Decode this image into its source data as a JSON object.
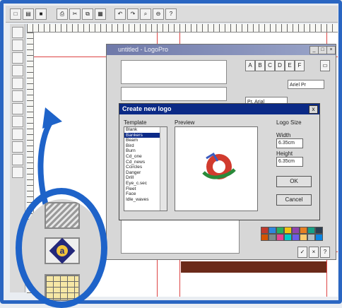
{
  "toolbar": {
    "icons": [
      "new-icon",
      "open-icon",
      "save-icon",
      "print-icon",
      "cut-icon",
      "copy-icon",
      "paste-icon",
      "undo-icon",
      "redo-icon",
      "zoom-icon",
      "zoom-out-icon",
      "help-icon"
    ]
  },
  "editor_window": {
    "title": "untitled - LogoPro",
    "text_style_buttons": [
      "A",
      "B",
      "C",
      "D",
      "E",
      "F"
    ],
    "font_combo_value": "Ariel Pr",
    "style_combo_value": "Pr. Arial"
  },
  "dialog": {
    "title": "Create new logo",
    "template_label": "Template",
    "preview_label": "Preview",
    "logo_size_label": "Logo Size",
    "width_label": "Width",
    "width_value": "6.35cm",
    "height_label": "Height",
    "height_value": "6.35cm",
    "ok_label": "OK",
    "cancel_label": "Cancel",
    "close_glyph": "x",
    "templates": [
      "Blank",
      "Bankers",
      "Beam",
      "Bird",
      "Burn",
      "Cd_one",
      "Cd_news",
      "Ccircles",
      "Danger",
      "Drill",
      "Eye_c.sec",
      "Fleet",
      "Face",
      "Idle_waves"
    ],
    "selected_template_index": 1
  },
  "colors": {
    "frame_blue": "#2a66c2",
    "dialog_titlebar": "#0b2a86",
    "guide_red": "#d44444",
    "brown_bar": "#6b2a19",
    "palette": [
      "#c0392b",
      "#2e86de",
      "#27ae60",
      "#f1c40f",
      "#8e44ad",
      "#e67e22",
      "#16a085",
      "#2c3e50",
      "#d35400",
      "#7f8c8d",
      "#e84393",
      "#00cec9",
      "#6c5ce7",
      "#fdcb6e",
      "#b2bec3",
      "#0984e3"
    ]
  },
  "callout": {
    "zoomed_tool_icon": "a",
    "zoomed_icons": [
      "pattern-icon",
      "logo-a-icon",
      "table-icon"
    ]
  }
}
